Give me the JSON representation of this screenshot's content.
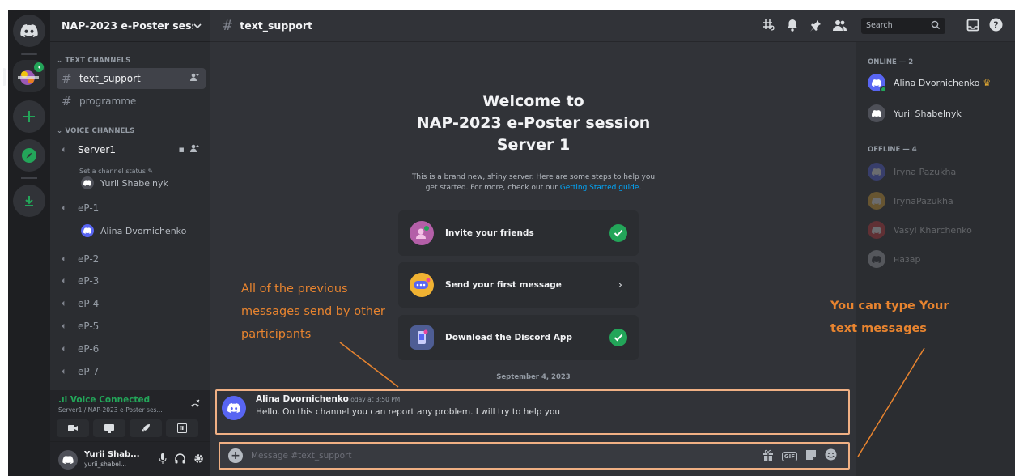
{
  "app": {
    "guild_name": "NAP-2023 e-Poster sess...",
    "channel_title": "text_support"
  },
  "sidebar": {
    "text_category": "TEXT CHANNELS",
    "text_channels": [
      {
        "label": "text_support"
      },
      {
        "label": "programme"
      }
    ],
    "voice_category": "VOICE CHANNELS",
    "voice_main": {
      "label": "Server1",
      "status": "Set a channel status",
      "user": "Yurii Shabelnyk"
    },
    "voice_channels": [
      {
        "label": "eP-1",
        "user": "Alina Dvornichenko"
      },
      {
        "label": "eP-2"
      },
      {
        "label": "eP-3"
      },
      {
        "label": "eP-4"
      },
      {
        "label": "eP-5"
      },
      {
        "label": "eP-6"
      },
      {
        "label": "eP-7"
      }
    ],
    "voice_panel": {
      "title": "Voice Connected",
      "subtitle": "Server1 / NAP-2023 e-Poster ses..."
    },
    "user_panel": {
      "name": "Yurii Shab...",
      "tag": "yurii_shabel..."
    }
  },
  "main": {
    "welcome_lines": [
      "Welcome to",
      "NAP-2023 e-Poster session",
      "Server 1"
    ],
    "welcome_sub_1": "This is a brand new, shiny server. Here are some steps to help you",
    "welcome_sub_2": "get started. For more, check out our ",
    "welcome_link": "Getting Started guide",
    "welcome_sub_end": ".",
    "cards": [
      {
        "label": "Invite your friends",
        "done": true
      },
      {
        "label": "Send your first message",
        "done": false
      },
      {
        "label": "Download the Discord App",
        "done": true
      }
    ],
    "date_divider": "September 4, 2023",
    "message": {
      "author": "Alina Dvornichenko",
      "time": "Today at 3:50 PM",
      "text": "Hello. On this channel you can report any problem.  I will try to help you"
    },
    "composer_placeholder": "Message #text_support"
  },
  "toolbar": {
    "search_placeholder": "Search"
  },
  "members": {
    "online_header": "ONLINE — 2",
    "online": [
      {
        "name": "Alina Dvornichenko",
        "crown": true
      },
      {
        "name": "Yurii Shabelnyk",
        "crown": false
      }
    ],
    "offline_header": "OFFLINE — 4",
    "offline": [
      {
        "name": "Iryna Pazukha"
      },
      {
        "name": "IrynaPazukha"
      },
      {
        "name": "Vasyl Kharchenko"
      },
      {
        "name": "назар"
      }
    ]
  },
  "annotations": {
    "left": [
      "All of the previous",
      "messages send by other",
      "participants"
    ],
    "right": [
      "You can type Your",
      "text messages"
    ]
  },
  "colors": {
    "accent": "#5865f2",
    "green": "#23a559",
    "annotation": "#e8842f",
    "avatar_orange": "#f0b232",
    "avatar_red": "#da373c"
  }
}
